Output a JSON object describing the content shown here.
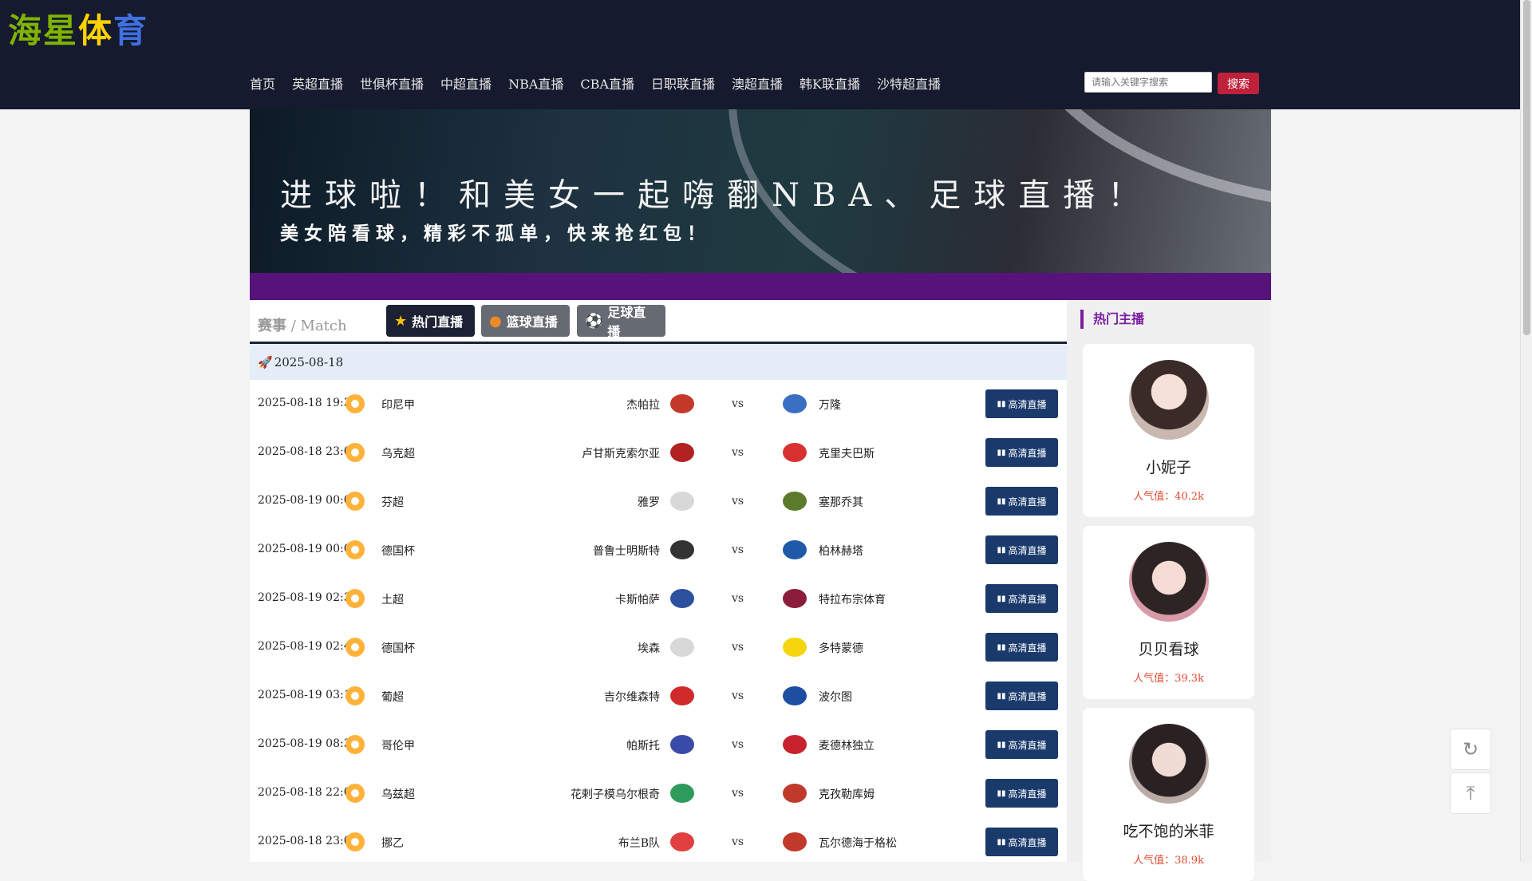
{
  "logo": {
    "c1": "海星",
    "c2": "体",
    "c3": "育"
  },
  "nav": [
    "首页",
    "英超直播",
    "世俱杯直播",
    "中超直播",
    "NBA直播",
    "CBA直播",
    "日职联直播",
    "澳超直播",
    "韩K联直播",
    "沙特超直播"
  ],
  "search": {
    "placeholder": "请输入关键字搜索",
    "button": "搜索"
  },
  "banner": {
    "headline": "进球啦！和美女一起嗨翻NBA、足球直播！",
    "subline": "美女陪看球，精彩不孤单，快来抢红包！"
  },
  "match": {
    "title_cn": "赛事",
    "title_sep": " / ",
    "title_en": "Match",
    "tabs": [
      {
        "label": "热门直播",
        "icon": "★"
      },
      {
        "label": "篮球直播",
        "icon": "●"
      },
      {
        "label": "足球直播",
        "icon": "⚽"
      }
    ],
    "date_icon": "🚀",
    "date": "2025-08-18",
    "vs": "vs",
    "live_label": "高清直播",
    "live_icon": "▮▮",
    "rows": [
      {
        "time": "2025-08-18 19:30",
        "league": "印尼甲",
        "home": "杰帕拉",
        "away": "万隆",
        "hcolor": "#c43a2a",
        "acolor": "#3a6fc4"
      },
      {
        "time": "2025-08-18 23:00",
        "league": "乌克超",
        "home": "卢甘斯克索尔亚",
        "away": "克里夫巴斯",
        "hcolor": "#b22222",
        "acolor": "#d93030"
      },
      {
        "time": "2025-08-19 00:00",
        "league": "芬超",
        "home": "雅罗",
        "away": "塞那乔其",
        "hcolor": "#d8d8d8",
        "acolor": "#5b7a2a"
      },
      {
        "time": "2025-08-19 00:00",
        "league": "德国杯",
        "home": "普鲁士明斯特",
        "away": "柏林赫塔",
        "hcolor": "#333333",
        "acolor": "#1e5aa8"
      },
      {
        "time": "2025-08-19 02:30",
        "league": "土超",
        "home": "卡斯帕萨",
        "away": "特拉布宗体育",
        "hcolor": "#2c4f9e",
        "acolor": "#8b1d3a"
      },
      {
        "time": "2025-08-19 02:45",
        "league": "德国杯",
        "home": "埃森",
        "away": "多特蒙德",
        "hcolor": "#d8d8d8",
        "acolor": "#f6d40e"
      },
      {
        "time": "2025-08-19 03:15",
        "league": "葡超",
        "home": "吉尔维森特",
        "away": "波尔图",
        "hcolor": "#d02b2b",
        "acolor": "#1d4ea0"
      },
      {
        "time": "2025-08-19 08:30",
        "league": "哥伦甲",
        "home": "帕斯托",
        "away": "麦德林独立",
        "hcolor": "#3a4aa8",
        "acolor": "#c8232c"
      },
      {
        "time": "2025-08-18 22:00",
        "league": "乌兹超",
        "home": "花剌子模乌尔根奇",
        "away": "克孜勒库姆",
        "hcolor": "#2e9b5a",
        "acolor": "#c0392b"
      },
      {
        "time": "2025-08-18 23:00",
        "league": "挪乙",
        "home": "布兰B队",
        "away": "瓦尔德海于格松",
        "hcolor": "#e04040",
        "acolor": "#c0392b"
      }
    ]
  },
  "sidebar": {
    "title": "热门主播",
    "streamers": [
      {
        "name": "小妮子",
        "popularity": "人气值：40.2k",
        "bg": "#c9b8b0"
      },
      {
        "name": "贝贝看球",
        "popularity": "人气值：39.3k",
        "bg": "#d99aa8"
      },
      {
        "name": "吃不饱的米菲",
        "popularity": "人气值：38.9k",
        "bg": "#b9aaa6"
      }
    ]
  },
  "float": {
    "refresh_icon": "↻",
    "top_icon": "⤒"
  }
}
